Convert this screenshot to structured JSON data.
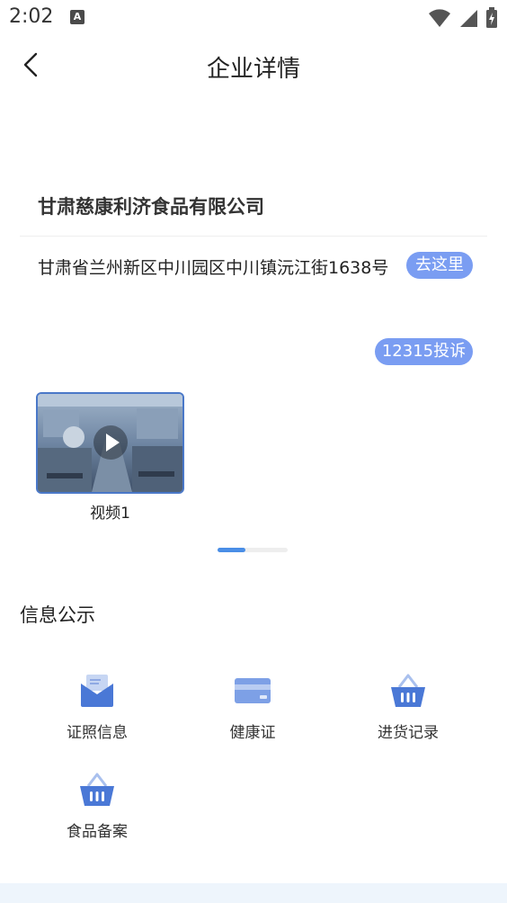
{
  "status_bar": {
    "time": "2:02",
    "notification_icon_letter": "A"
  },
  "nav": {
    "title": "企业详情"
  },
  "company": {
    "name": "甘肃慈康利济食品有限公司",
    "address": "甘肃省兰州新区中川园区中川镇沅江街1638号",
    "go_label": "去这里",
    "complaint_label": "12315投诉"
  },
  "media": {
    "videos": [
      {
        "label": "视频1"
      }
    ],
    "scroll_progress": 0.4
  },
  "info_section": {
    "title": "信息公示",
    "items": [
      {
        "label": "证照信息",
        "icon": "envelope-icon"
      },
      {
        "label": "健康证",
        "icon": "card-icon"
      },
      {
        "label": "进货记录",
        "icon": "basket-icon"
      },
      {
        "label": "食品备案",
        "icon": "basket-icon"
      }
    ]
  },
  "colors": {
    "accent": "#7a9df2",
    "icon_blue": "#4a78d6",
    "scroll_thumb": "#4a8ee6"
  }
}
